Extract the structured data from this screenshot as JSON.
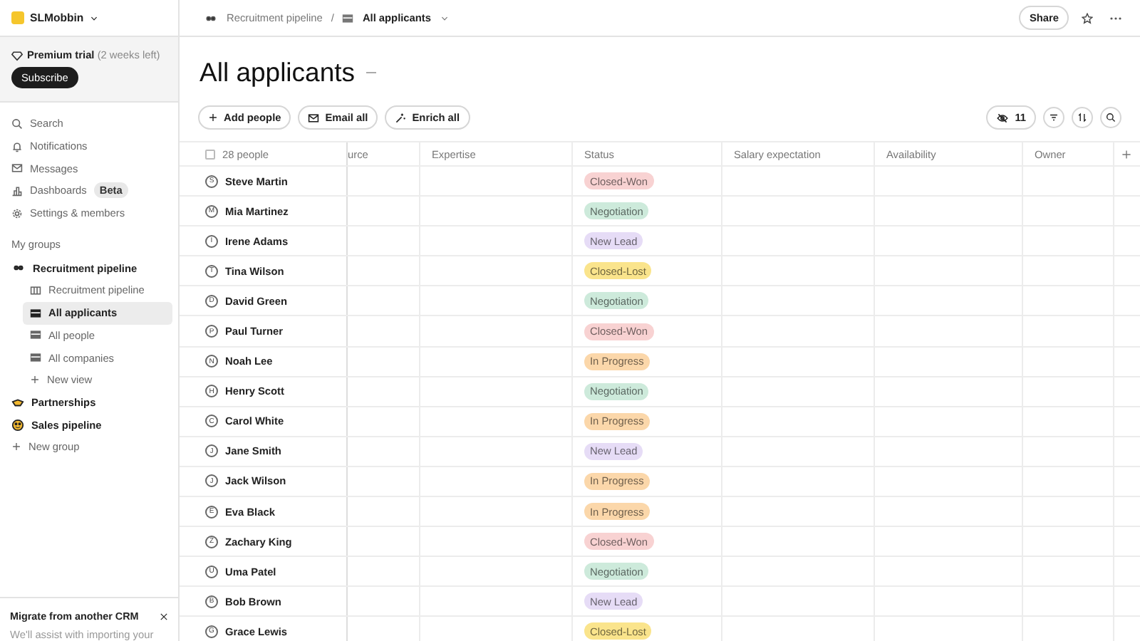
{
  "sidebar": {
    "workspace": "SLMobbin",
    "trial": {
      "label": "Premium trial",
      "note": "(2 weeks left)",
      "button": "Subscribe"
    },
    "nav": [
      {
        "label": "Search"
      },
      {
        "label": "Notifications"
      },
      {
        "label": "Messages"
      },
      {
        "label": "Dashboards",
        "badge": "Beta"
      },
      {
        "label": "Settings & members"
      }
    ],
    "groups_heading": "My groups",
    "groups": [
      {
        "label": "Recruitment pipeline",
        "expanded": true,
        "children": [
          {
            "label": "Recruitment pipeline",
            "selected": false
          },
          {
            "label": "All applicants",
            "selected": true
          },
          {
            "label": "All people",
            "selected": false
          },
          {
            "label": "All companies",
            "selected": false
          }
        ],
        "new_view": "New view"
      },
      {
        "label": "Partnerships",
        "expanded": false
      },
      {
        "label": "Sales pipeline",
        "expanded": false
      }
    ],
    "new_group": "New group",
    "promo": {
      "title": "Migrate from another CRM",
      "text": "We'll assist with importing your"
    }
  },
  "breadcrumb_separator": "/",
  "breadcrumb": [
    {
      "label": "Recruitment pipeline"
    },
    {
      "label": "All applicants"
    }
  ],
  "share": "Share",
  "title": "All applicants",
  "actions": [
    "Add people",
    "Email all",
    "Enrich all"
  ],
  "hidden_count": "11",
  "table": {
    "count": "28 people",
    "all_checked": false,
    "columns": [
      "urce",
      "Expertise",
      "Status",
      "Salary expectation",
      "Availability",
      "Owner"
    ],
    "rows": [
      {
        "initial": "S",
        "name": "Steve Martin",
        "status": "Closed-Won",
        "color": "#f8d2d2"
      },
      {
        "initial": "M",
        "name": "Mia Martinez",
        "status": "Negotiation",
        "color": "#cdeadb"
      },
      {
        "initial": "I",
        "name": "Irene Adams",
        "status": "New Lead",
        "color": "#e6dcf6"
      },
      {
        "initial": "T",
        "name": "Tina Wilson",
        "status": "Closed-Lost",
        "color": "#fae48c"
      },
      {
        "initial": "D",
        "name": "David Green",
        "status": "Negotiation",
        "color": "#cdeadb"
      },
      {
        "initial": "P",
        "name": "Paul Turner",
        "status": "Closed-Won",
        "color": "#f8d2d2"
      },
      {
        "initial": "N",
        "name": "Noah Lee",
        "status": "In Progress",
        "color": "#fbd7aa"
      },
      {
        "initial": "H",
        "name": "Henry Scott",
        "status": "Negotiation",
        "color": "#cdeadb"
      },
      {
        "initial": "C",
        "name": "Carol White",
        "status": "In Progress",
        "color": "#fbd7aa"
      },
      {
        "initial": "J",
        "name": "Jane Smith",
        "status": "New Lead",
        "color": "#e6dcf6"
      },
      {
        "initial": "J",
        "name": "Jack Wilson",
        "status": "In Progress",
        "color": "#fbd7aa"
      },
      {
        "initial": "E",
        "name": "Eva Black",
        "status": "In Progress",
        "color": "#fbd7aa"
      },
      {
        "initial": "Z",
        "name": "Zachary King",
        "status": "Closed-Won",
        "color": "#f8d2d2"
      },
      {
        "initial": "U",
        "name": "Uma Patel",
        "status": "Negotiation",
        "color": "#cdeadb"
      },
      {
        "initial": "B",
        "name": "Bob Brown",
        "status": "New Lead",
        "color": "#e6dcf6"
      },
      {
        "initial": "G",
        "name": "Grace Lewis",
        "status": "Closed-Lost",
        "color": "#fae48c"
      }
    ]
  }
}
